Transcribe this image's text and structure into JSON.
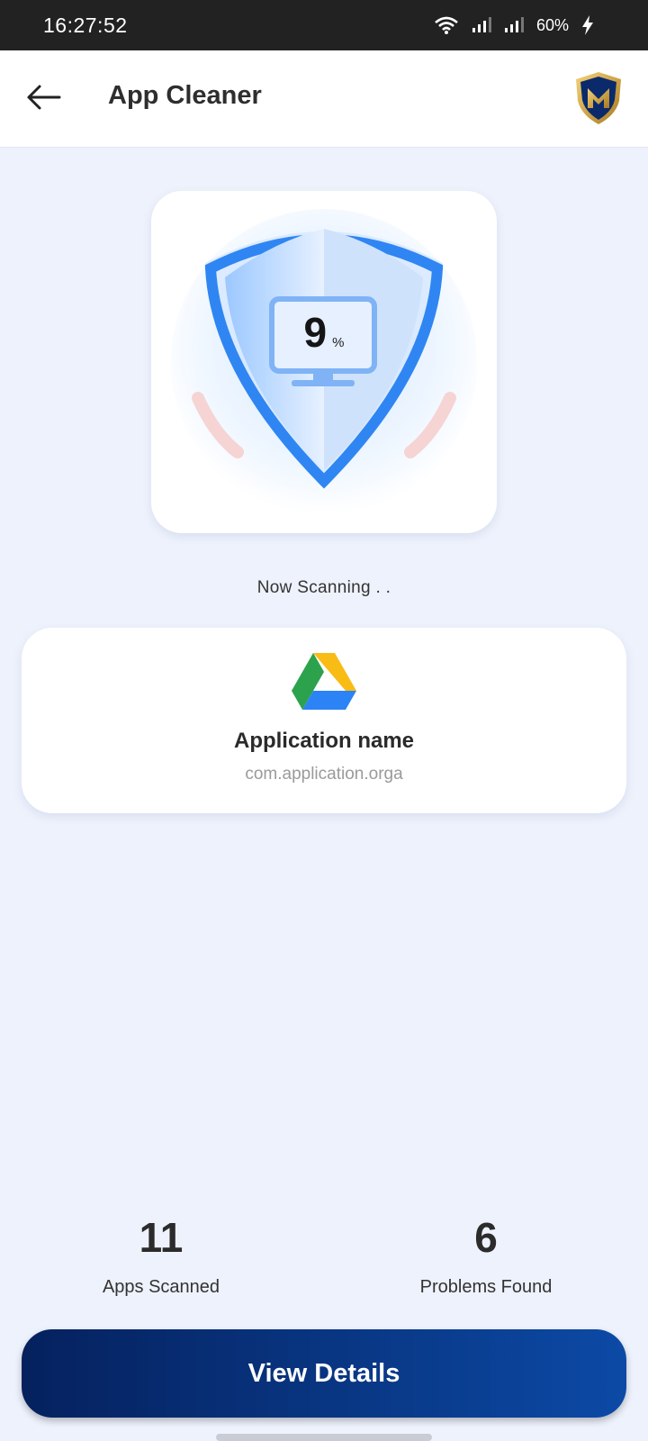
{
  "status_bar": {
    "time": "16:27:52",
    "battery": "60%",
    "icons": [
      "wifi-icon",
      "signal-icon",
      "signal-icon",
      "charging-icon"
    ]
  },
  "app_bar": {
    "title": "App Cleaner",
    "back_icon": "arrow-left-icon",
    "logo_icon": "shield-m-logo-icon"
  },
  "scan": {
    "percent": "9",
    "percent_sign": "%",
    "status_text": "Now Scanning . ."
  },
  "current_app": {
    "icon": "google-drive-icon",
    "name": "Application name",
    "package": "com.application.orga"
  },
  "stats": {
    "apps_scanned_value": "11",
    "apps_scanned_label": "Apps Scanned",
    "problems_found_value": "6",
    "problems_found_label": "Problems Found"
  },
  "actions": {
    "view_details_label": "View Details"
  },
  "colors": {
    "background": "#eef2fc",
    "accent_blue": "#2f86f2",
    "button_dark": "#05215e",
    "button_light": "#0c4aa6"
  }
}
